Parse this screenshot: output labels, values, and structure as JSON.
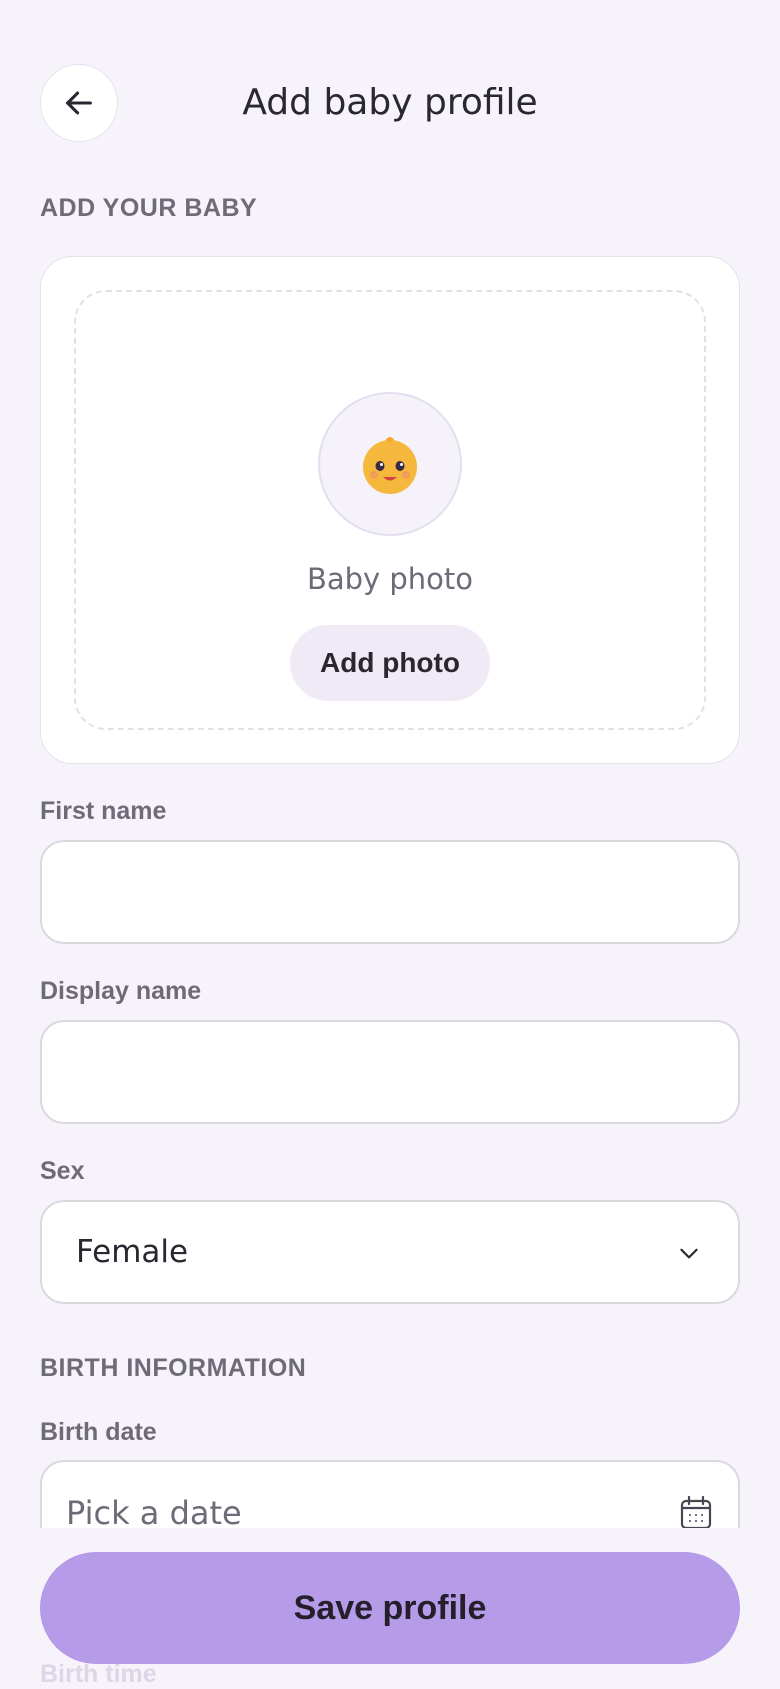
{
  "header": {
    "title": "Add baby profile"
  },
  "sections": {
    "add_baby": "ADD YOUR BABY",
    "birth_info": "BIRTH INFORMATION"
  },
  "photo": {
    "caption": "Baby photo",
    "add_label": "Add photo",
    "emoji": "👶"
  },
  "form": {
    "first_name": {
      "label": "First name",
      "value": "",
      "placeholder": ""
    },
    "display_name": {
      "label": "Display name",
      "value": "",
      "placeholder": ""
    },
    "sex": {
      "label": "Sex",
      "value": "Female"
    },
    "birth_date": {
      "label": "Birth date",
      "placeholder": "Pick a date"
    },
    "birth_time": {
      "label": "Birth time"
    }
  },
  "footer": {
    "save_label": "Save profile"
  },
  "colors": {
    "accent": "#b69be8",
    "background": "#f6f4fa"
  }
}
